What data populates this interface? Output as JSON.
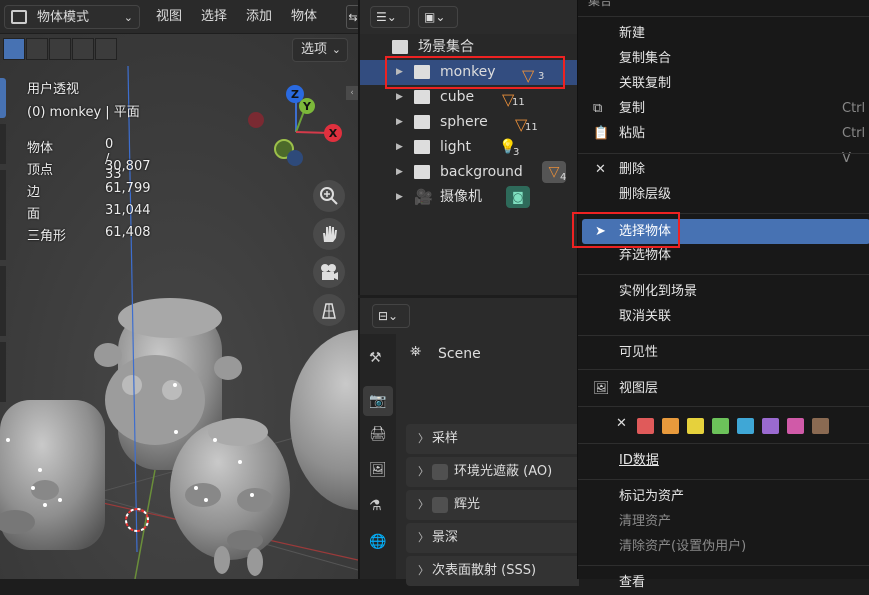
{
  "viewport": {
    "mode_label": "物体模式",
    "menu": [
      "视图",
      "选择",
      "添加",
      "物体"
    ],
    "options_label": "选项",
    "view_name": "用户透视",
    "active_object": "(0) monkey | 平面",
    "stats": [
      {
        "label": "物体",
        "value": "0 / 33"
      },
      {
        "label": "顶点",
        "value": "30,807"
      },
      {
        "label": "边",
        "value": "61,799"
      },
      {
        "label": "面",
        "value": "31,044"
      },
      {
        "label": "三角形",
        "value": "61,408"
      }
    ],
    "gizmo": {
      "z": "Z",
      "y": "Y",
      "x": "X"
    }
  },
  "outliner": {
    "scene_collection": "场景集合",
    "rows": [
      {
        "label": "monkey",
        "badge": "3"
      },
      {
        "label": "cube",
        "badge": "11"
      },
      {
        "label": "sphere",
        "badge": "11"
      },
      {
        "label": "light",
        "badge": "3"
      },
      {
        "label": "background",
        "badge": "4"
      },
      {
        "label": "摄像机",
        "badge": ""
      }
    ]
  },
  "properties": {
    "scene_name": "Scene",
    "panels": [
      "采样",
      "环境光遮蔽 (AO)",
      "辉光",
      "景深",
      "次表面散射 (SSS)"
    ]
  },
  "menu": {
    "title": "集合",
    "items": {
      "new": "新建",
      "dup_collection": "复制集合",
      "linked_dup": "关联复制",
      "copy": "复制",
      "copy_sc": "Ctrl",
      "paste": "粘贴",
      "paste_sc": "Ctrl V",
      "delete": "删除",
      "delete_hier": "删除层级",
      "select_objects": "选择物体",
      "deselect_objects": "弃选物体",
      "instance_to_scene": "实例化到场景",
      "unlink": "取消关联",
      "visibility": "可见性",
      "view_layer": "视图层",
      "id_data": "ID数据",
      "mark_asset": "标记为资产",
      "clear_asset": "清理资产",
      "clear_asset_fake": "清除资产(设置伪用户)",
      "cut_off": "查看"
    },
    "color_tags": [
      "#e05a5a",
      "#e89a3c",
      "#e6d13c",
      "#6cc25a",
      "#3fa7d6",
      "#9a6ad0",
      "#d05aa8",
      "#8a6a52"
    ],
    "accent": "#4772b3"
  }
}
